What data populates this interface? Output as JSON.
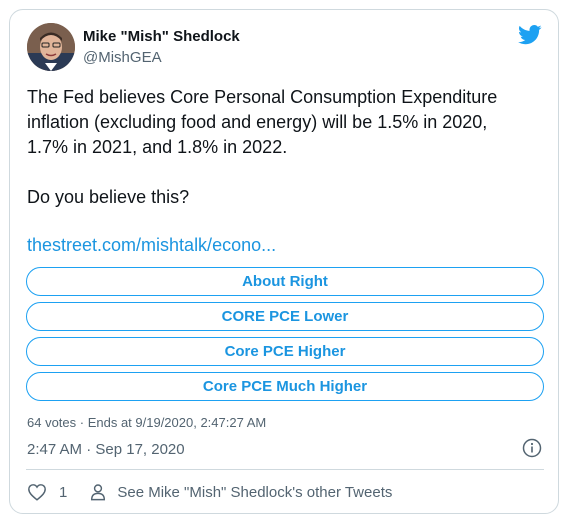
{
  "author": {
    "name": "Mike \"Mish\" Shedlock",
    "handle": "@MishGEA"
  },
  "tweet": {
    "line1": "The Fed believes Core Personal Consumption Expenditure",
    "line2": "inflation (excluding food and energy) will be 1.5% in 2020,",
    "line3": "1.7% in 2021, and 1.8% in 2022.",
    "line4": "Do you believe this?",
    "link": "thestreet.com/mishtalk/econo..."
  },
  "poll": {
    "options": [
      {
        "label": "About Right"
      },
      {
        "label": "CORE PCE Lower"
      },
      {
        "label": "Core PCE Higher"
      },
      {
        "label": "Core PCE Much Higher"
      }
    ],
    "status": "64 votes · Ends at 9/19/2020, 2:47:27 AM"
  },
  "meta": {
    "timestamp": "2:47 AM · Sep 17, 2020"
  },
  "actions": {
    "like_count": "1",
    "other_tweets": "See Mike \"Mish\" Shedlock's other Tweets"
  },
  "icons": {
    "brand": "twitter-bird-icon",
    "info": "info-icon",
    "like": "heart-icon",
    "profile": "person-icon"
  },
  "colors": {
    "accent": "#1da1f2",
    "link": "#1b95e0",
    "muted": "#536471",
    "text": "#0f1419",
    "border": "#cfd9de"
  }
}
